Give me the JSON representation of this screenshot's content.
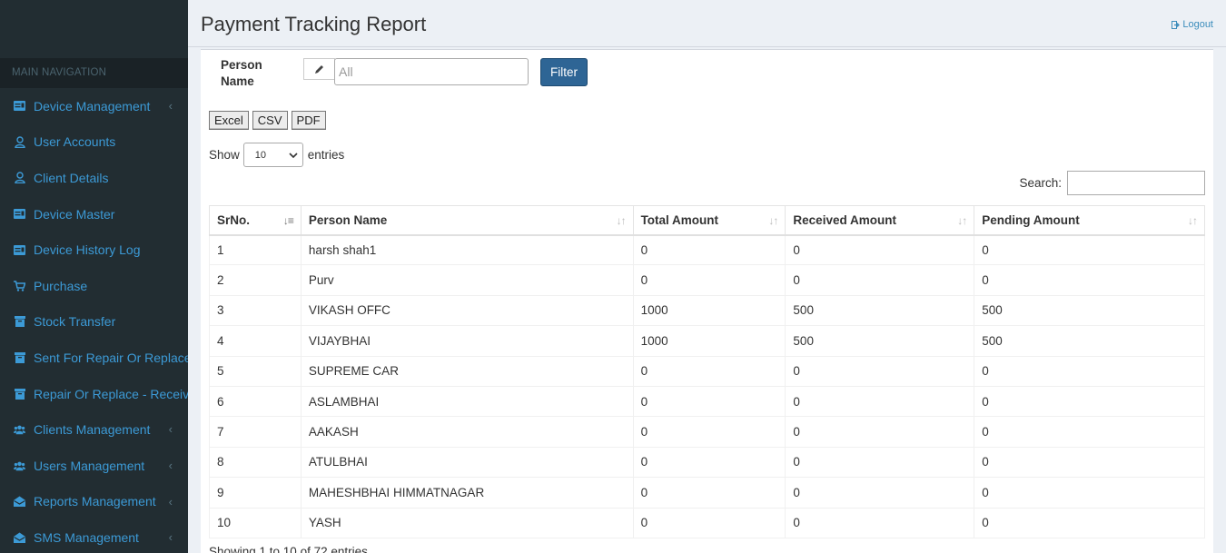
{
  "nav": {
    "header": "MAIN NAVIGATION",
    "items": [
      {
        "label": "Device Management",
        "icon": "id-card-icon",
        "chevron": true
      },
      {
        "label": "User Accounts",
        "icon": "user-icon",
        "chevron": false
      },
      {
        "label": "Client Details",
        "icon": "user-icon",
        "chevron": false
      },
      {
        "label": "Device Master",
        "icon": "id-card-icon",
        "chevron": false
      },
      {
        "label": "Device History Log",
        "icon": "id-card-icon",
        "chevron": false
      },
      {
        "label": "Purchase",
        "icon": "cart-icon",
        "chevron": false
      },
      {
        "label": "Stock Transfer",
        "icon": "archive-icon",
        "chevron": false
      },
      {
        "label": "Sent For Repair Or Replace",
        "icon": "archive-icon",
        "chevron": false
      },
      {
        "label": "Repair Or Replace - Received",
        "icon": "archive-icon",
        "chevron": false
      },
      {
        "label": "Clients Management",
        "icon": "users-icon",
        "chevron": true
      },
      {
        "label": "Users Management",
        "icon": "users-icon",
        "chevron": true
      },
      {
        "label": "Reports Management",
        "icon": "envelope-open-icon",
        "chevron": true
      },
      {
        "label": "SMS Management",
        "icon": "envelope-open-icon",
        "chevron": true
      }
    ],
    "chevron_glyph": "‹"
  },
  "header": {
    "title": "Payment Tracking Report",
    "logout": "Logout"
  },
  "filter": {
    "label": "Person Name",
    "input_value": "All",
    "button": "Filter"
  },
  "export_buttons": [
    "Excel",
    "CSV",
    "PDF"
  ],
  "length": {
    "prefix": "Show",
    "value": "10",
    "suffix": "entries"
  },
  "search": {
    "label": "Search:"
  },
  "table": {
    "columns": [
      "SrNo.",
      "Person Name",
      "Total Amount",
      "Received Amount",
      "Pending Amount"
    ],
    "rows": [
      [
        "1",
        "harsh shah1",
        "0",
        "0",
        "0"
      ],
      [
        "2",
        "Purv",
        "0",
        "0",
        "0"
      ],
      [
        "3",
        "VIKASH OFFC",
        "1000",
        "500",
        "500"
      ],
      [
        "4",
        "VIJAYBHAI",
        "1000",
        "500",
        "500"
      ],
      [
        "5",
        "SUPREME CAR",
        "0",
        "0",
        "0"
      ],
      [
        "6",
        "ASLAMBHAI",
        "0",
        "0",
        "0"
      ],
      [
        "7",
        "AAKASH",
        "0",
        "0",
        "0"
      ],
      [
        "8",
        "ATULBHAI",
        "0",
        "0",
        "0"
      ],
      [
        "9",
        "MAHESHBHAI HIMMATNAGAR",
        "0",
        "0",
        "0"
      ],
      [
        "10",
        "YASH",
        "0",
        "0",
        "0"
      ]
    ]
  },
  "info": "Showing 1 to 10 of 72 entries",
  "colors": {
    "sidebar_bg": "#222d32",
    "sidebar_link": "#3c9ad6",
    "filter_button": "#2e6595",
    "page_bg": "#ecf0f5"
  }
}
